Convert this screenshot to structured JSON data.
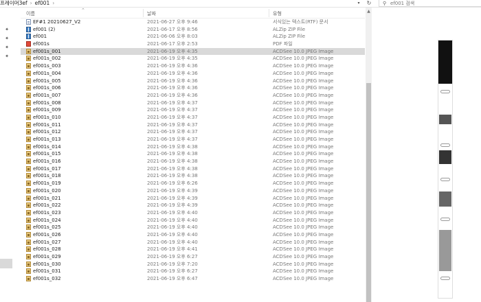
{
  "breadcrumb": {
    "folder": "프레이머3ef",
    "current": "ef001",
    "separator": "›"
  },
  "search": {
    "placeholder": "ef001 검색"
  },
  "columns": {
    "name": "이름",
    "date": "날짜",
    "type": "유형"
  },
  "files": [
    {
      "name": "EF#1 20210627_V2",
      "date": "2021-06-27 오후 9:46",
      "type": "서식있는 텍스트(RTF) 문서",
      "icon": "rtf-icon"
    },
    {
      "name": "ef001 (2)",
      "date": "2021-06-17 오후 8:56",
      "type": "ALZip ZIP File",
      "icon": "zip-icon"
    },
    {
      "name": "ef001",
      "date": "2021-06-06 오후 8:03",
      "type": "ALZip ZIP File",
      "icon": "zip-icon"
    },
    {
      "name": "ef001s",
      "date": "2021-06-17 오후 2:53",
      "type": "PDF 파일",
      "icon": "pdf-icon"
    },
    {
      "name": "ef001s_001",
      "date": "2021-06-19 오후 4:35",
      "type": "ACDSee 10.0 JPEG Image",
      "icon": "jpeg-icon",
      "selected": true
    },
    {
      "name": "ef001s_002",
      "date": "2021-06-19 오후 4:35",
      "type": "ACDSee 10.0 JPEG Image",
      "icon": "jpeg-icon"
    },
    {
      "name": "ef001s_003",
      "date": "2021-06-19 오후 4:36",
      "type": "ACDSee 10.0 JPEG Image",
      "icon": "jpeg-icon"
    },
    {
      "name": "ef001s_004",
      "date": "2021-06-19 오후 4:36",
      "type": "ACDSee 10.0 JPEG Image",
      "icon": "jpeg-icon"
    },
    {
      "name": "ef001s_005",
      "date": "2021-06-19 오후 4:36",
      "type": "ACDSee 10.0 JPEG Image",
      "icon": "jpeg-icon"
    },
    {
      "name": "ef001s_006",
      "date": "2021-06-19 오후 4:36",
      "type": "ACDSee 10.0 JPEG Image",
      "icon": "jpeg-icon"
    },
    {
      "name": "ef001s_007",
      "date": "2021-06-19 오후 4:36",
      "type": "ACDSee 10.0 JPEG Image",
      "icon": "jpeg-icon"
    },
    {
      "name": "ef001s_008",
      "date": "2021-06-19 오후 4:37",
      "type": "ACDSee 10.0 JPEG Image",
      "icon": "jpeg-icon"
    },
    {
      "name": "ef001s_009",
      "date": "2021-06-19 오후 4:37",
      "type": "ACDSee 10.0 JPEG Image",
      "icon": "jpeg-icon"
    },
    {
      "name": "ef001s_010",
      "date": "2021-06-19 오후 4:37",
      "type": "ACDSee 10.0 JPEG Image",
      "icon": "jpeg-icon"
    },
    {
      "name": "ef001s_011",
      "date": "2021-06-19 오후 4:37",
      "type": "ACDSee 10.0 JPEG Image",
      "icon": "jpeg-icon"
    },
    {
      "name": "ef001s_012",
      "date": "2021-06-19 오후 4:37",
      "type": "ACDSee 10.0 JPEG Image",
      "icon": "jpeg-icon"
    },
    {
      "name": "ef001s_013",
      "date": "2021-06-19 오후 4:37",
      "type": "ACDSee 10.0 JPEG Image",
      "icon": "jpeg-icon"
    },
    {
      "name": "ef001s_014",
      "date": "2021-06-19 오후 4:38",
      "type": "ACDSee 10.0 JPEG Image",
      "icon": "jpeg-icon"
    },
    {
      "name": "ef001s_015",
      "date": "2021-06-19 오후 4:38",
      "type": "ACDSee 10.0 JPEG Image",
      "icon": "jpeg-icon"
    },
    {
      "name": "ef001s_016",
      "date": "2021-06-19 오후 4:38",
      "type": "ACDSee 10.0 JPEG Image",
      "icon": "jpeg-icon"
    },
    {
      "name": "ef001s_017",
      "date": "2021-06-19 오후 4:38",
      "type": "ACDSee 10.0 JPEG Image",
      "icon": "jpeg-icon"
    },
    {
      "name": "ef001s_018",
      "date": "2021-06-19 오후 4:38",
      "type": "ACDSee 10.0 JPEG Image",
      "icon": "jpeg-icon"
    },
    {
      "name": "ef001s_019",
      "date": "2021-06-19 오후 6:26",
      "type": "ACDSee 10.0 JPEG Image",
      "icon": "jpeg-icon"
    },
    {
      "name": "ef001s_020",
      "date": "2021-06-19 오후 4:39",
      "type": "ACDSee 10.0 JPEG Image",
      "icon": "jpeg-icon"
    },
    {
      "name": "ef001s_021",
      "date": "2021-06-19 오후 4:39",
      "type": "ACDSee 10.0 JPEG Image",
      "icon": "jpeg-icon"
    },
    {
      "name": "ef001s_022",
      "date": "2021-06-19 오후 4:39",
      "type": "ACDSee 10.0 JPEG Image",
      "icon": "jpeg-icon"
    },
    {
      "name": "ef001s_023",
      "date": "2021-06-19 오후 4:40",
      "type": "ACDSee 10.0 JPEG Image",
      "icon": "jpeg-icon"
    },
    {
      "name": "ef001s_024",
      "date": "2021-06-19 오후 4:40",
      "type": "ACDSee 10.0 JPEG Image",
      "icon": "jpeg-icon"
    },
    {
      "name": "ef001s_025",
      "date": "2021-06-19 오후 4:40",
      "type": "ACDSee 10.0 JPEG Image",
      "icon": "jpeg-icon"
    },
    {
      "name": "ef001s_026",
      "date": "2021-06-19 오후 4:40",
      "type": "ACDSee 10.0 JPEG Image",
      "icon": "jpeg-icon"
    },
    {
      "name": "ef001s_027",
      "date": "2021-06-19 오후 4:40",
      "type": "ACDSee 10.0 JPEG Image",
      "icon": "jpeg-icon"
    },
    {
      "name": "ef001s_028",
      "date": "2021-06-19 오후 4:41",
      "type": "ACDSee 10.0 JPEG Image",
      "icon": "jpeg-icon"
    },
    {
      "name": "ef001s_029",
      "date": "2021-06-19 오후 6:27",
      "type": "ACDSee 10.0 JPEG Image",
      "icon": "jpeg-icon"
    },
    {
      "name": "ef001s_030",
      "date": "2021-06-19 오후 7:20",
      "type": "ACDSee 10.0 JPEG Image",
      "icon": "jpeg-icon"
    },
    {
      "name": "ef001s_031",
      "date": "2021-06-19 오후 6:27",
      "type": "ACDSee 10.0 JPEG Image",
      "icon": "jpeg-icon"
    },
    {
      "name": "ef001s_032",
      "date": "2021-06-19 오후 6:47",
      "type": "ACDSee 10.0 JPEG Image",
      "icon": "jpeg-icon"
    }
  ],
  "icons": {
    "sort": "chevron-up-icon",
    "refresh": "refresh-icon",
    "search": "search-icon",
    "pin": "pin-icon",
    "dropdown": "chevron-down-icon"
  },
  "colors": {
    "selection": "#d9d9d9",
    "meta_text": "#777777"
  }
}
